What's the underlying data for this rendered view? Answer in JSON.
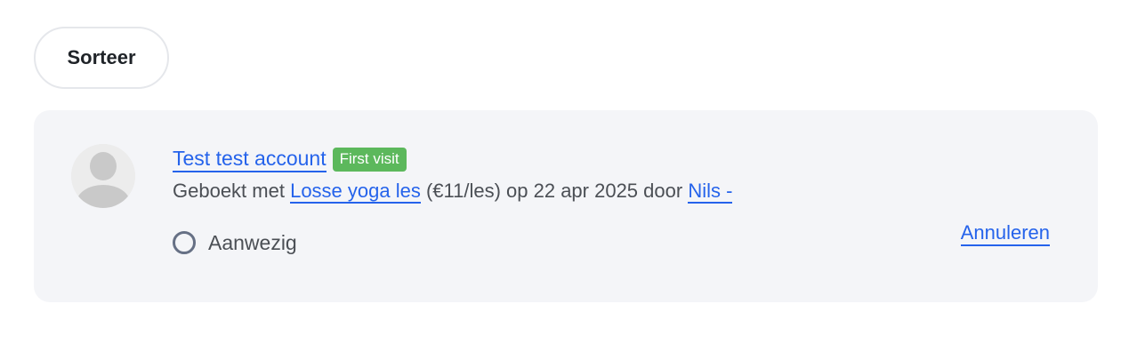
{
  "toolbar": {
    "sort_label": "Sorteer"
  },
  "booking": {
    "member_name": "Test test account",
    "badge": "First visit",
    "booked_with_prefix": "Geboekt met ",
    "class_name": "Losse yoga les",
    "price": " (€11/les) op 22 apr 2025 door ",
    "booked_by": "Nils -",
    "attendance_label": "Aanwezig",
    "cancel_label": "Annuleren"
  },
  "colors": {
    "link": "#2563eb",
    "badge_bg": "#5cb85c",
    "card_bg": "#f4f5f8"
  },
  "icons": {
    "avatar": "user-placeholder-icon",
    "attendance": "radio-unchecked-icon"
  }
}
